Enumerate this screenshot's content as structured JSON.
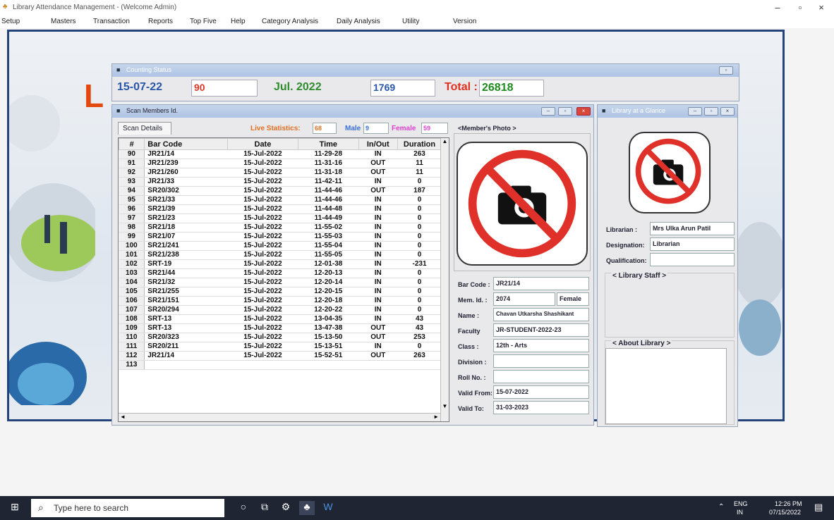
{
  "app": {
    "title": "Library Attendance Management - (Welcome Admin)"
  },
  "menu": [
    "Setup",
    "Masters",
    "Transaction",
    "Reports",
    "Top Five",
    "Help",
    "Category Analysis",
    "Daily Analysis",
    "Utility",
    "Version"
  ],
  "counting_status": {
    "title": "Counting Status",
    "date": "15-07-22",
    "count": "90",
    "month": "Jul. 2022",
    "month_count": "1769",
    "total_label": "Total :",
    "total": "26818"
  },
  "scan": {
    "title": "Scan Members Id.",
    "tab": "Scan Details",
    "live_label": "Live Statistics:",
    "live_value": "68",
    "male_label": "Male",
    "male_value": "9",
    "female_label": "Female",
    "female_value": "59",
    "columns": [
      "#",
      "Bar Code",
      "Date",
      "Time",
      "In/Out",
      "Duration"
    ],
    "rows": [
      [
        "90",
        "JR21/14",
        "15-Jul-2022",
        "11-29-28",
        "IN",
        "263"
      ],
      [
        "91",
        "JR21/239",
        "15-Jul-2022",
        "11-31-16",
        "OUT",
        "11"
      ],
      [
        "92",
        "JR21/260",
        "15-Jul-2022",
        "11-31-18",
        "OUT",
        "11"
      ],
      [
        "93",
        "JR21/33",
        "15-Jul-2022",
        "11-42-11",
        "IN",
        "0"
      ],
      [
        "94",
        "SR20/302",
        "15-Jul-2022",
        "11-44-46",
        "OUT",
        "187"
      ],
      [
        "95",
        "SR21/33",
        "15-Jul-2022",
        "11-44-46",
        "IN",
        "0"
      ],
      [
        "96",
        "SR21/39",
        "15-Jul-2022",
        "11-44-48",
        "IN",
        "0"
      ],
      [
        "97",
        "SR21/23",
        "15-Jul-2022",
        "11-44-49",
        "IN",
        "0"
      ],
      [
        "98",
        "SR21/18",
        "15-Jul-2022",
        "11-55-02",
        "IN",
        "0"
      ],
      [
        "99",
        "SR21/07",
        "15-Jul-2022",
        "11-55-03",
        "IN",
        "0"
      ],
      [
        "100",
        "SR21/241",
        "15-Jul-2022",
        "11-55-04",
        "IN",
        "0"
      ],
      [
        "101",
        "SR21/238",
        "15-Jul-2022",
        "11-55-05",
        "IN",
        "0"
      ],
      [
        "102",
        "SRT-19",
        "15-Jul-2022",
        "12-01-38",
        "IN",
        "-231"
      ],
      [
        "103",
        "SR21/44",
        "15-Jul-2022",
        "12-20-13",
        "IN",
        "0"
      ],
      [
        "104",
        "SR21/32",
        "15-Jul-2022",
        "12-20-14",
        "IN",
        "0"
      ],
      [
        "105",
        "SR21/255",
        "15-Jul-2022",
        "12-20-15",
        "IN",
        "0"
      ],
      [
        "106",
        "SR21/151",
        "15-Jul-2022",
        "12-20-18",
        "IN",
        "0"
      ],
      [
        "107",
        "SR20/294",
        "15-Jul-2022",
        "12-20-22",
        "IN",
        "0"
      ],
      [
        "108",
        "SRT-13",
        "15-Jul-2022",
        "13-04-35",
        "IN",
        "43"
      ],
      [
        "109",
        "SRT-13",
        "15-Jul-2022",
        "13-47-38",
        "OUT",
        "43"
      ],
      [
        "110",
        "SR20/323",
        "15-Jul-2022",
        "15-13-50",
        "OUT",
        "253"
      ],
      [
        "111",
        "SR20/211",
        "15-Jul-2022",
        "15-13-51",
        "IN",
        "0"
      ],
      [
        "112",
        "JR21/14",
        "15-Jul-2022",
        "15-52-51",
        "OUT",
        "263"
      ],
      [
        "113",
        "",
        "",
        "",
        "",
        ""
      ]
    ]
  },
  "member": {
    "photo_label": "<Member's Photo >",
    "bar_code_label": "Bar Code :",
    "bar_code": "JR21/14",
    "mem_id_label": "Mem. Id. :",
    "mem_id": "2074",
    "gender": "Female",
    "name_label": "Name :",
    "name": "Chavan Utkarsha Shashikant",
    "faculty_label": "Faculty",
    "faculty": "JR-STUDENT-2022-23",
    "class_label": "Class :",
    "class": "12th - Arts",
    "division_label": "Division :",
    "division": "",
    "roll_label": "Roll No. :",
    "roll": "",
    "valid_from_label": "Valid From:",
    "valid_from": "15-07-2022",
    "valid_to_label": "Valid To:",
    "valid_to": "31-03-2023"
  },
  "glance": {
    "title": "Library at a Glance",
    "librarian_label": "Librarian :",
    "librarian": "Mrs Ulka Arun Patil",
    "designation_label": "Designation:",
    "designation": "Librarian",
    "qualification_label": "Qualification:",
    "qualification": "",
    "staff_label": "< Library Staff >",
    "about_label": "< About Library >"
  },
  "taskbar": {
    "search_placeholder": "Type here to search",
    "lang": "ENG",
    "region": "IN",
    "time": "12:26 PM",
    "date": "07/15/2022"
  },
  "colors": {
    "frame": "#25457a",
    "date_blue": "#2856a8",
    "count_red": "#d83a2a",
    "month_green": "#2e8b2e",
    "total_red": "#e0301e",
    "total_green": "#1d8b1d",
    "live_orange": "#e07020",
    "male_blue": "#3a6fd8",
    "female_pink": "#e040d0"
  }
}
